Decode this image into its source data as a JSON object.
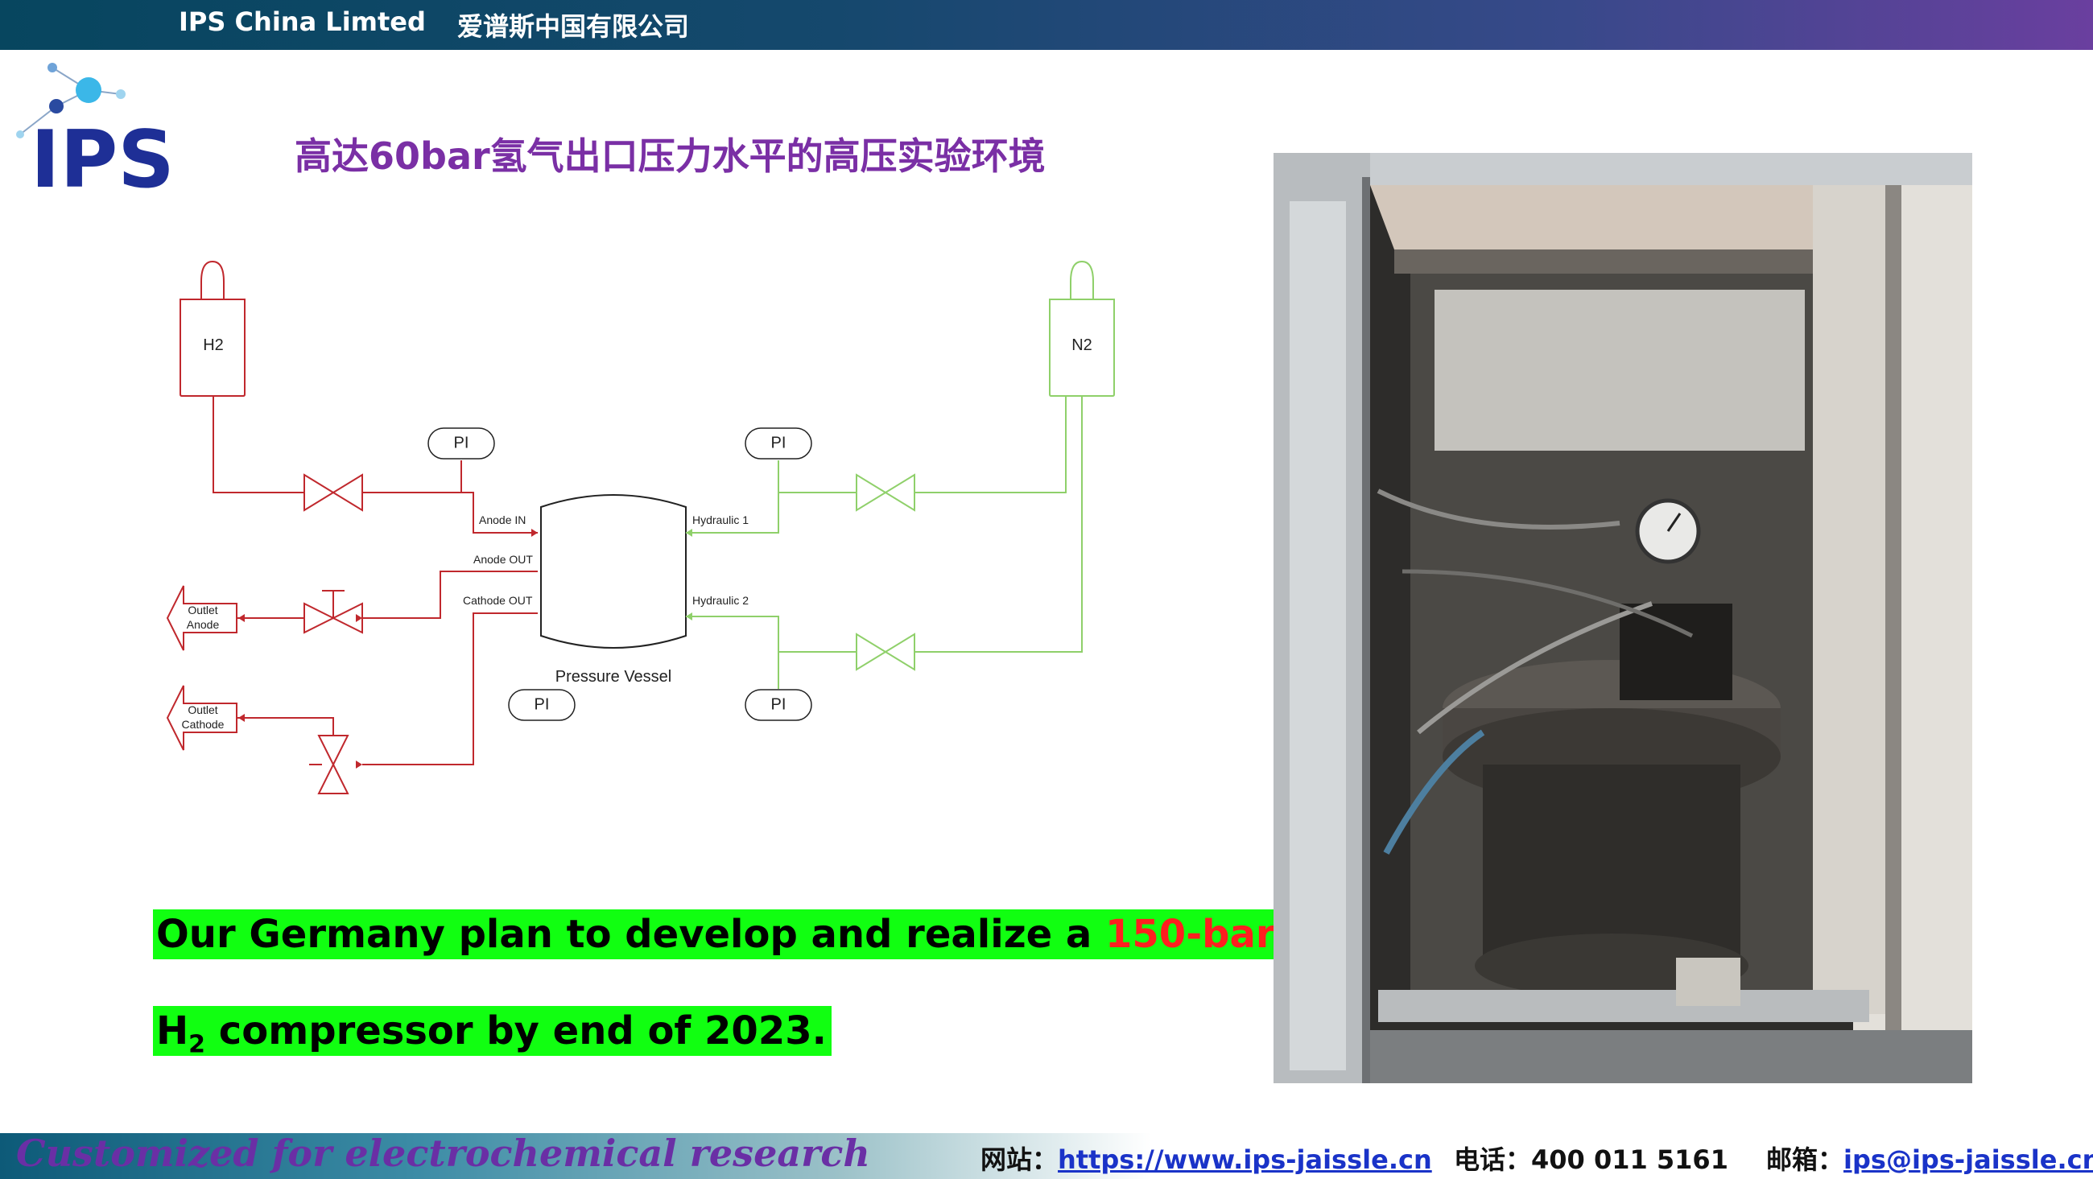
{
  "header": {
    "company_en": "IPS China Limted",
    "company_cn": "爱谱斯中国有限公司"
  },
  "logo": {
    "text": "IPS"
  },
  "title": "高达60bar氢气出口压力水平的高压实验环境",
  "diagram": {
    "h2_label": "H2",
    "n2_label": "N2",
    "pi_label": "PI",
    "anode_in": "Anode IN",
    "anode_out": "Anode OUT",
    "cathode_out": "Cathode OUT",
    "hydraulic1": "Hydraulic 1",
    "hydraulic2": "Hydraulic 2",
    "vessel_label": "Pressure Vessel",
    "outlet": "Outlet",
    "anode": "Anode",
    "cathode": "Cathode",
    "colors": {
      "hydrogen_line": "#c0282d",
      "nitrogen_line": "#8fd06a",
      "equipment": "#222222"
    }
  },
  "highlight": {
    "line1_prefix": "Our Germany plan to develop and realize a ",
    "line1_red": "150-bar",
    "line2_h": "H",
    "line2_sub": "2",
    "line2_rest": " compressor by end of 2023."
  },
  "footer": {
    "tagline": "Customized for electrochemical research",
    "web_label": "网站：",
    "web_url": "https://www.ips-jaissle.cn",
    "phone_label": "电话：",
    "phone": "400 011 5161",
    "email_label": "邮箱：",
    "email": "ips@ips-jaissle.cn"
  }
}
